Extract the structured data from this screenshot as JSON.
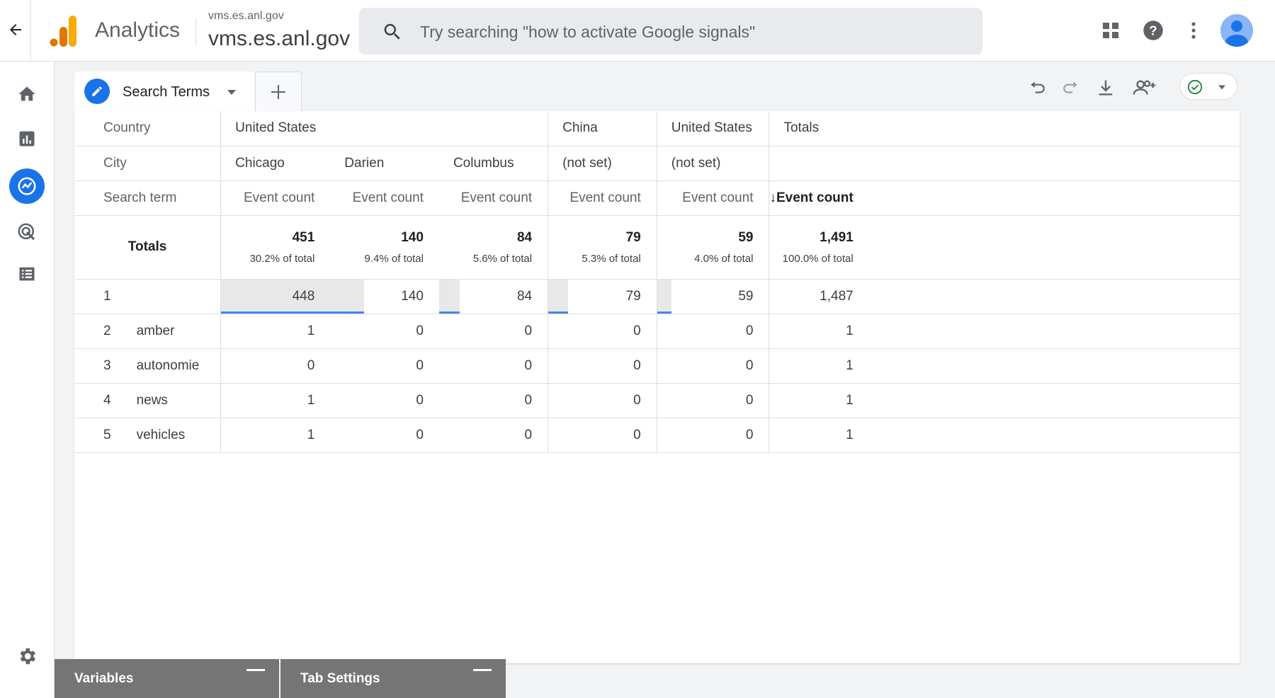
{
  "topbar": {
    "app_name": "Analytics",
    "account_name": "vms.es.anl.gov",
    "property_name": "vms.es.anl.gov",
    "search_placeholder": "Try searching \"how to activate Google signals\""
  },
  "icons": {
    "back": "arrow-left-icon",
    "apps": "apps-grid-icon",
    "help": "help-icon",
    "more": "more-vert-icon",
    "account": "account-circle-icon"
  },
  "leftnav": [
    {
      "name": "home-icon",
      "active": false
    },
    {
      "name": "reports-icon",
      "active": false
    },
    {
      "name": "explore-icon",
      "active": true
    },
    {
      "name": "advertising-icon",
      "active": false
    },
    {
      "name": "configure-icon",
      "active": false
    },
    {
      "name": "admin-settings-icon",
      "active": false
    }
  ],
  "tab": {
    "label": "Search Terms"
  },
  "toolbar": [
    "undo-icon",
    "redo-icon",
    "download-icon",
    "share-icon",
    "status-check-icon"
  ],
  "colors": {
    "accent": "#1a73e8",
    "bar": "#4285f4",
    "check": "#188038"
  },
  "table": {
    "row_headers": {
      "country": "Country",
      "city": "City",
      "search_term": "Search term"
    },
    "columns": [
      {
        "country": "United States",
        "city": "Chicago",
        "metric": "Event count",
        "total": "451",
        "total_pct": "30.2% of total",
        "bar_fraction": 1.0
      },
      {
        "country": "",
        "city": "Darien",
        "metric": "Event count",
        "total": "140",
        "total_pct": "9.4% of total",
        "bar_fraction": 0.31
      },
      {
        "country": "",
        "city": "Columbus",
        "metric": "Event count",
        "total": "84",
        "total_pct": "5.6% of total",
        "bar_fraction": 0.19
      },
      {
        "country": "China",
        "city": "(not set)",
        "metric": "Event count",
        "total": "79",
        "total_pct": "5.3% of total",
        "bar_fraction": 0.18
      },
      {
        "country": "United States",
        "city": "(not set)",
        "metric": "Event count",
        "total": "59",
        "total_pct": "4.0% of total",
        "bar_fraction": 0.13
      },
      {
        "country": "Totals",
        "city": "",
        "metric": "Event count",
        "total": "1,491",
        "total_pct": "100.0% of total",
        "bar_fraction": 0
      }
    ],
    "totals_label": "Totals",
    "rows": [
      {
        "index": "1",
        "term": "",
        "values": [
          "448",
          "140",
          "84",
          "79",
          "59",
          "1,487"
        ]
      },
      {
        "index": "2",
        "term": "amber",
        "values": [
          "1",
          "0",
          "0",
          "0",
          "0",
          "1"
        ]
      },
      {
        "index": "3",
        "term": "autonomie",
        "values": [
          "0",
          "0",
          "0",
          "0",
          "0",
          "1"
        ]
      },
      {
        "index": "4",
        "term": "news",
        "values": [
          "1",
          "0",
          "0",
          "0",
          "0",
          "1"
        ]
      },
      {
        "index": "5",
        "term": "vehicles",
        "values": [
          "1",
          "0",
          "0",
          "0",
          "0",
          "1"
        ]
      }
    ]
  },
  "bottom_tabs": {
    "variables": "Variables",
    "tab_settings": "Tab Settings"
  }
}
